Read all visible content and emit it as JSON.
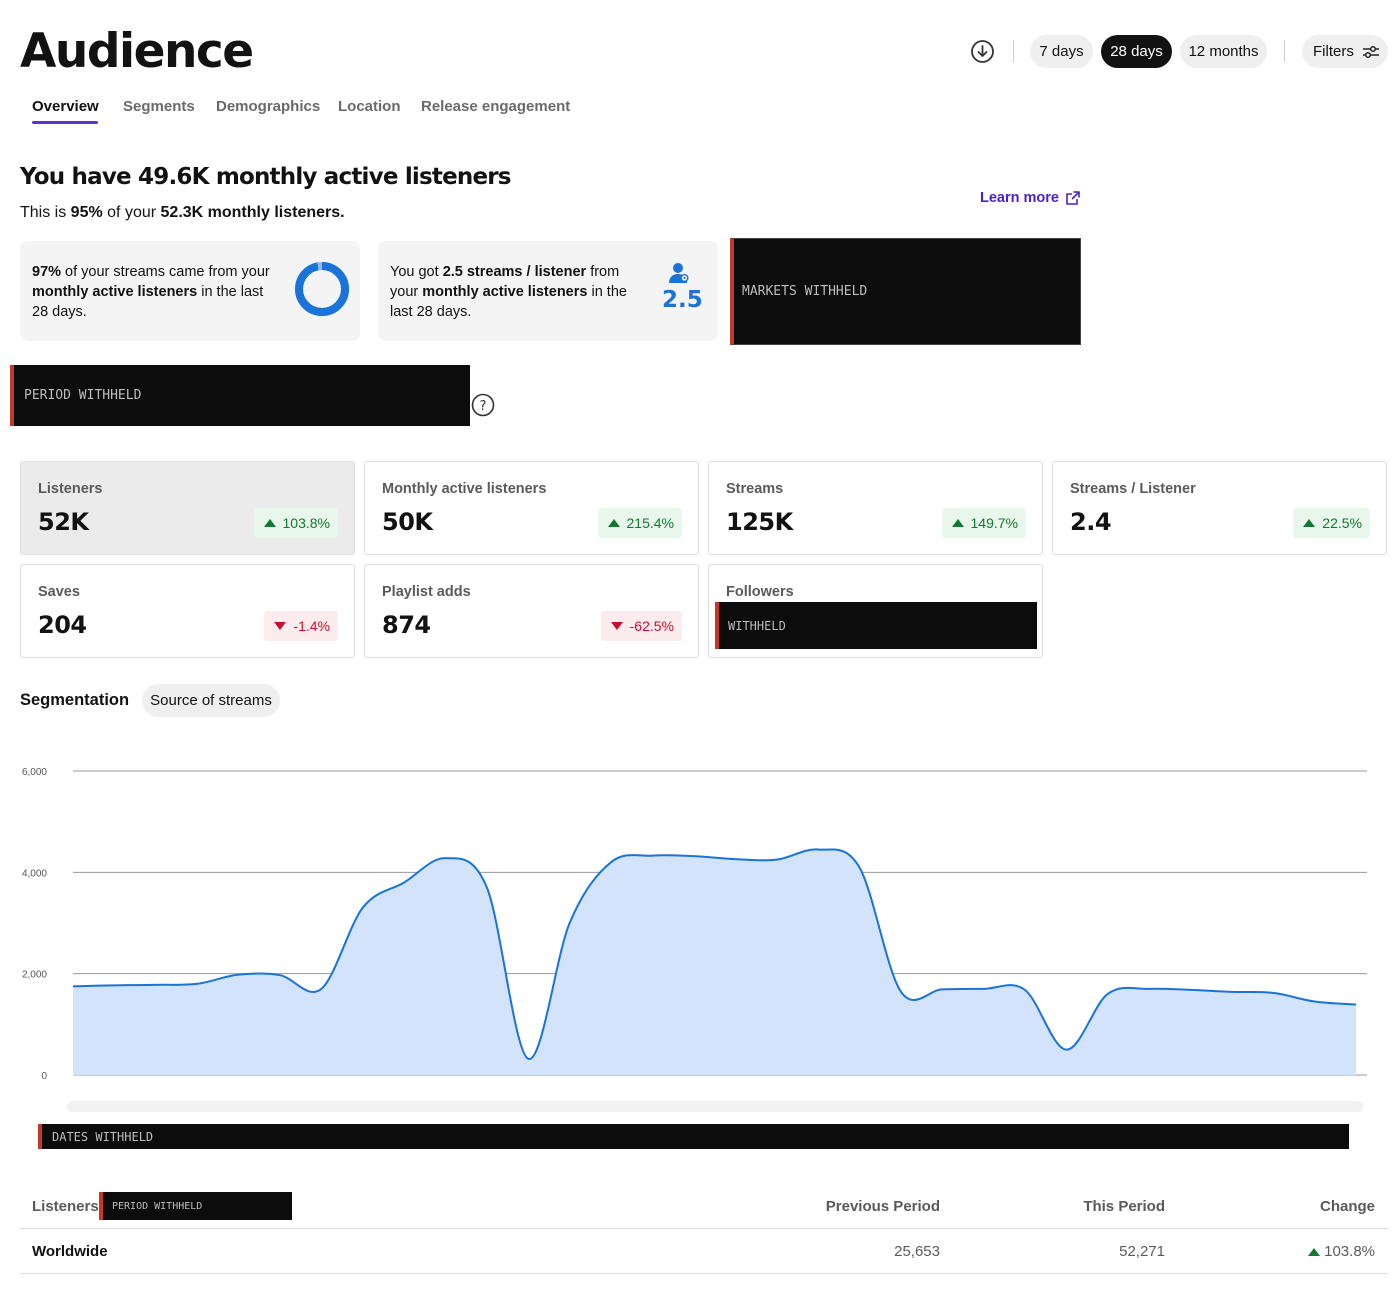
{
  "header": {
    "title": "Audience",
    "periods": [
      "7 days",
      "28 days",
      "12 months"
    ],
    "active_period": "28 days",
    "filters_label": "Filters"
  },
  "tabs": [
    "Overview",
    "Segments",
    "Demographics",
    "Location",
    "Release engagement"
  ],
  "active_tab": "Overview",
  "summary": {
    "headline_prefix": "You have ",
    "headline_value": "49.6K",
    "headline_suffix": " monthly active listeners",
    "sub_prefix": "This is ",
    "sub_pct": "95%",
    "sub_mid": " of your ",
    "sub_total": "52.3K monthly listeners.",
    "learn_more": "Learn more"
  },
  "info_cards": {
    "streams_share": {
      "pct": "97%",
      "t1": " of your streams came from your ",
      "bold": "monthly active listeners",
      "t2": " in the last 28 days.",
      "ring_fraction": 0.97
    },
    "streams_per_listener": {
      "t1": "You got ",
      "bold1": "2.5 streams / listener",
      "t2": " from your ",
      "bold2": "monthly active listeners",
      "t3": " in the last 28 days.",
      "value": "2.5"
    },
    "markets_redacted": "MARKETS WITHHELD"
  },
  "period_redacted": "PERIOD WITHHELD",
  "metrics": [
    {
      "label": "Listeners",
      "value": "52K",
      "change": "103.8%",
      "dir": "up"
    },
    {
      "label": "Monthly active listeners",
      "value": "50K",
      "change": "215.4%",
      "dir": "up"
    },
    {
      "label": "Streams",
      "value": "125K",
      "change": "149.7%",
      "dir": "up"
    },
    {
      "label": "Streams / Listener",
      "value": "2.4",
      "change": "22.5%",
      "dir": "up"
    },
    {
      "label": "Saves",
      "value": "204",
      "change": "-1.4%",
      "dir": "down"
    },
    {
      "label": "Playlist adds",
      "value": "874",
      "change": "-62.5%",
      "dir": "down"
    },
    {
      "label": "Followers",
      "value": "",
      "redacted": "WITHHELD"
    }
  ],
  "segmentation": {
    "label": "Segmentation",
    "chip": "Source of streams"
  },
  "chart_data": {
    "type": "area",
    "y_ticks": [
      "6,000",
      "4,000",
      "2,000",
      "0"
    ],
    "ylim": [
      0,
      6000
    ],
    "grid": true,
    "x": [
      1,
      2,
      3,
      4,
      5,
      6,
      7,
      8,
      9,
      10,
      11,
      12,
      13,
      14,
      15,
      16,
      17,
      18,
      19,
      20,
      21,
      22,
      23,
      24,
      25,
      26,
      27,
      28,
      29,
      30,
      31,
      32,
      33,
      34,
      35,
      36,
      37,
      38,
      39,
      40
    ],
    "series": [
      {
        "values": [
          1750,
          1770,
          1780,
          1800,
          1980,
          1970,
          1700,
          3300,
          3800,
          4280,
          3700,
          320,
          3000,
          4200,
          4330,
          4320,
          4260,
          4250,
          4450,
          4100,
          1650,
          1690,
          1700,
          1680,
          500,
          1600,
          1700,
          1680,
          1640,
          1620,
          1450,
          1390,
          null,
          null,
          null,
          null,
          null,
          null,
          null,
          null
        ]
      }
    ],
    "x_axis_redacted": "DATES WITHHELD",
    "colors": {
      "line": "#1a73d9",
      "fill": "#d3e3fb",
      "grid": "#9a9a9a"
    }
  },
  "table": {
    "title": "Listeners",
    "title_redacted": "PERIOD WITHHELD",
    "columns": [
      "Previous Period",
      "This Period",
      "Change"
    ],
    "rows": [
      {
        "name": "Worldwide",
        "prev": "25,653",
        "curr": "52,271",
        "change": "103.8%",
        "dir": "up"
      }
    ]
  },
  "colors": {
    "accent": "#5a33d6",
    "blue": "#1a73d9",
    "up": "#127a2e",
    "down": "#c8102e"
  }
}
